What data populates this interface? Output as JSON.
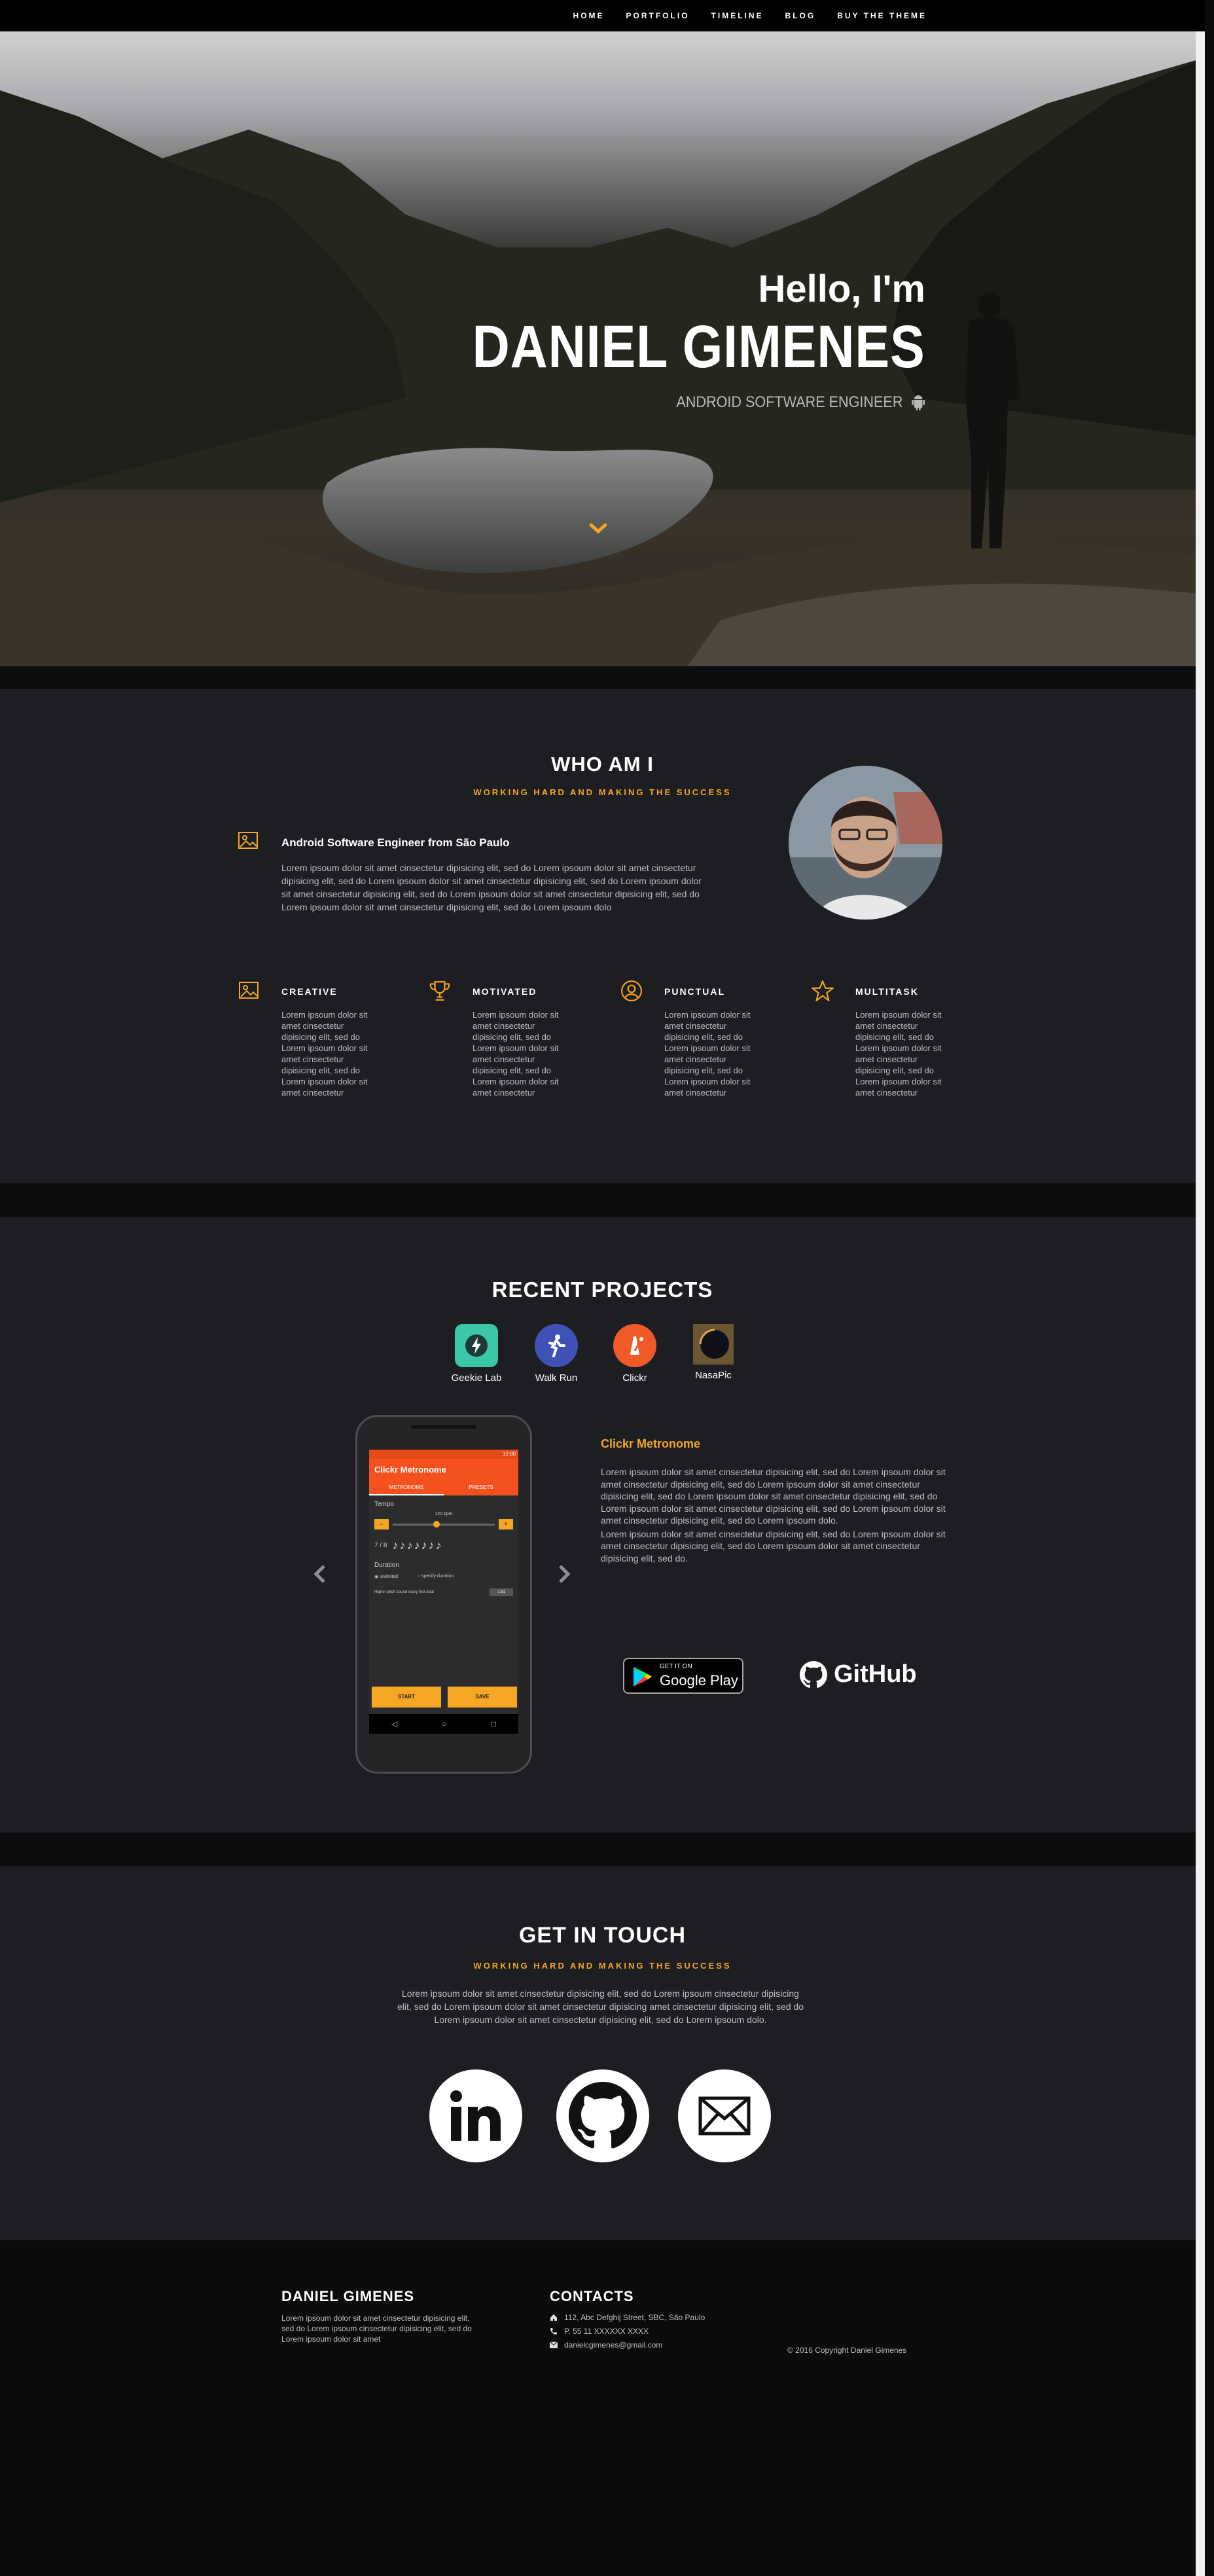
{
  "nav": {
    "items": [
      "HOME",
      "PORTFOLIO",
      "TIMELINE",
      "BLOG",
      "BUY THE THEME"
    ]
  },
  "hero": {
    "greeting": "Hello, I'm",
    "name": "DANIEL GIMENES",
    "role": "ANDROID SOFTWARE ENGINEER"
  },
  "about": {
    "title": "WHO AM I",
    "subtitle": "WORKING HARD AND MAKING THE SUCCESS",
    "intro_title": "Android Software Engineer from São Paulo",
    "intro_text": "Lorem ipsoum dolor sit amet cinsectetur dipisicing elit, sed do Lorem ipsoum dolor sit amet cinsectetur dipisicing elit, sed do Lorem ipsoum dolor sit amet cinsectetur dipisicing elit, sed do Lorem ipsoum dolor sit amet cinsectetur dipisicing elit, sed do Lorem ipsoum dolor sit amet cinsectetur dipisicing elit, sed do Lorem ipsoum dolor sit amet cinsectetur dipisicing elit, sed do Lorem ipsoum dolo",
    "features": [
      {
        "title": "CREATIVE",
        "text": "Lorem ipsoum dolor sit amet cinsectetur dipisicing elit, sed do Lorem ipsoum dolor sit amet cinsectetur dipisicing elit, sed do Lorem ipsoum dolor sit amet cinsectetur",
        "icon": "image-icon"
      },
      {
        "title": "MOTIVATED",
        "text": "Lorem ipsoum dolor sit amet cinsectetur dipisicing elit, sed do Lorem ipsoum dolor sit amet cinsectetur dipisicing elit, sed do Lorem ipsoum dolor sit amet cinsectetur",
        "icon": "trophy-icon"
      },
      {
        "title": "PUNCTUAL",
        "text": "Lorem ipsoum dolor sit amet cinsectetur dipisicing elit, sed do Lorem ipsoum dolor sit amet cinsectetur dipisicing elit, sed do Lorem ipsoum dolor sit amet cinsectetur",
        "icon": "user-icon"
      },
      {
        "title": "MULTITASK",
        "text": "Lorem ipsoum dolor sit amet cinsectetur dipisicing elit, sed do Lorem ipsoum dolor sit amet cinsectetur dipisicing elit, sed do Lorem ipsoum dolor sit amet cinsectetur",
        "icon": "star-icon"
      }
    ]
  },
  "projects": {
    "title": "RECENT PROJECTS",
    "items": [
      {
        "label": "Geekie Lab",
        "color": "#3bc7a8"
      },
      {
        "label": "Walk Run",
        "color": "#3f51b5"
      },
      {
        "label": "Clickr",
        "color": "#f05a28"
      },
      {
        "label": "NasaPic",
        "color": "#3a3a3a"
      }
    ],
    "phone": {
      "status_time": "12:00",
      "app_title": "Clickr Metronome",
      "tab_metronome": "METRONOME",
      "tab_presets": "PRESETS",
      "tempo_label": "Tempo",
      "tempo_value": "120 bpm",
      "minus": "-",
      "plus": "+",
      "signature": "7 / 8",
      "duration_label": "Duration",
      "opt_unlimited": "unlimited",
      "opt_specify": "specify duration",
      "pitch_label": "Higher pitch sound every first beat",
      "pitch_value": "1.91",
      "start": "START",
      "save": "SAVE"
    },
    "active_title": "Clickr Metronome",
    "active_text_1": "Lorem ipsoum dolor sit amet cinsectetur dipisicing elit, sed do Lorem ipsoum dolor sit amet cinsectetur dipisicing elit, sed do Lorem ipsoum dolor sit amet cinsectetur dipisicing elit, sed do Lorem ipsoum dolor sit amet cinsectetur dipisicing elit, sed do Lorem ipsoum dolor sit amet cinsectetur dipisicing elit, sed do Lorem ipsoum dolor sit amet cinsectetur dipisicing elit, sed do Lorem ipsoum dolo.",
    "active_text_2": "Lorem ipsoum dolor sit amet cinsectetur dipisicing elit, sed do Lorem ipsoum dolor sit amet cinsectetur dipisicing elit, sed do Lorem ipsoum dolor sit amet cinsectetur dipisicing elit, sed do.",
    "gplay_small": "GET IT ON",
    "gplay_big": "Google Play",
    "github": "GitHub"
  },
  "contact": {
    "title": "GET IN TOUCH",
    "subtitle": "WORKING HARD AND MAKING THE SUCCESS",
    "text": "Lorem ipsoum dolor sit amet cinsectetur dipisicing elit, sed do Lorem ipsoum cinsectetur dipisicing elit, sed do Lorem ipsoum dolor sit amet cinsectetur dipisicing amet cinsectetur dipisicing elit, sed do Lorem ipsoum dolor sit amet cinsectetur dipisicing elit, sed do Lorem ipsoum dolo."
  },
  "footer": {
    "name": "DANIEL GIMENES",
    "about_text": "Lorem ipsoum dolor sit amet cinsectetur dipisicing elit, sed do Lorem ipsoum  cinsectetur dipisicing elit, sed do Lorem ipsoum dolor sit amet",
    "contacts_title": "CONTACTS",
    "address": "112, Abc Defghij Street, SBC, São Paulo",
    "phone": "P. 55 11 XXXXXX XXXX",
    "email": "danielcgimenes@gmail.com",
    "copyright": "© 2016 Copyright Daniel Gimenes"
  },
  "colors": {
    "accent": "#f5a623",
    "section_bg": "#1c1e21",
    "band": "#0c0d0f"
  }
}
